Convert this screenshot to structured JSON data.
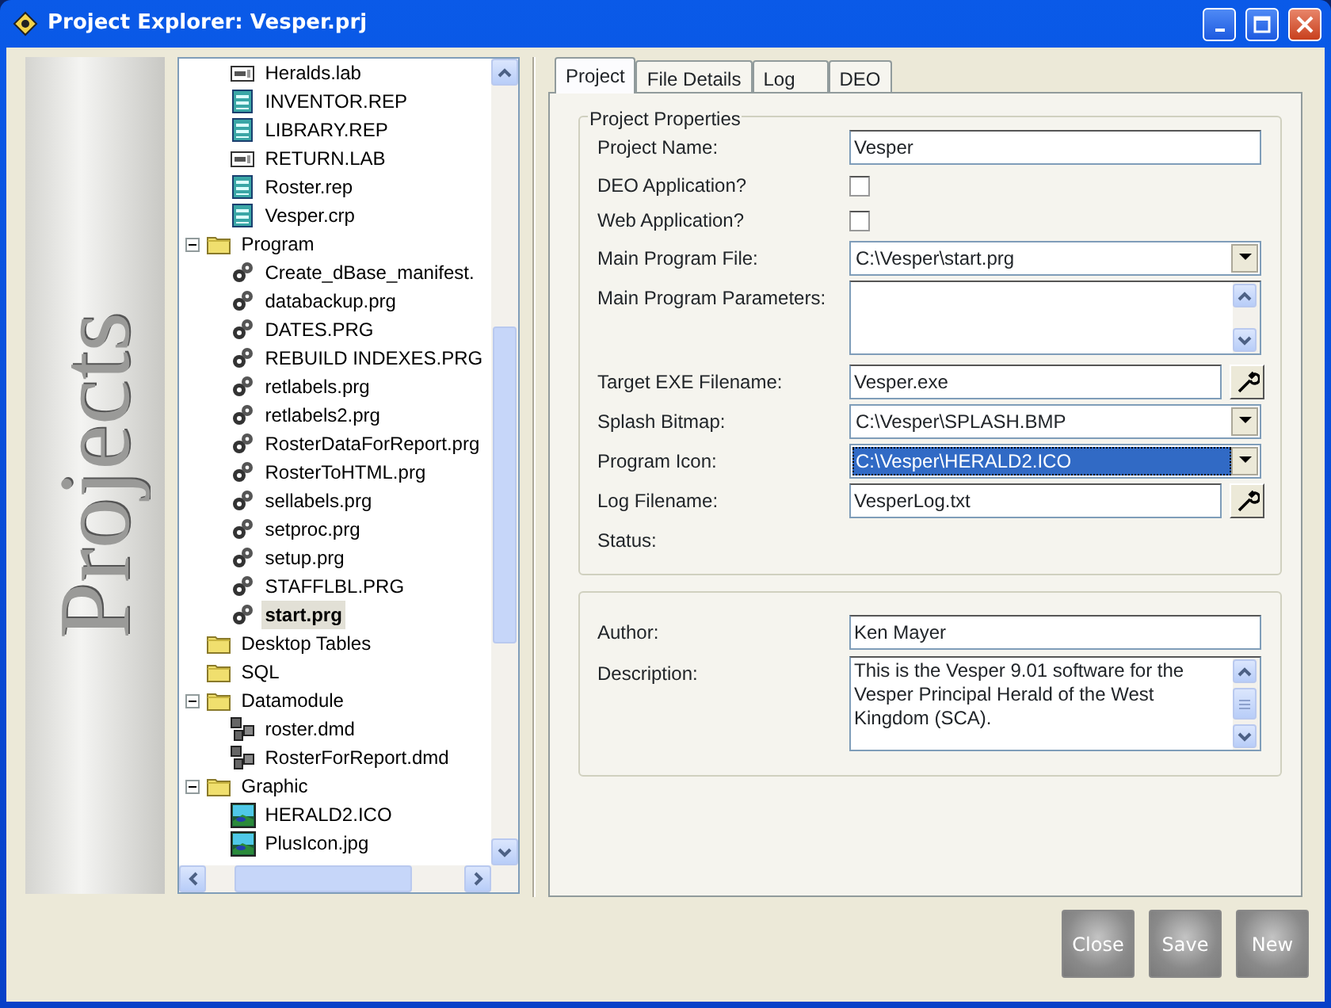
{
  "window": {
    "title": "Project Explorer: Vesper.prj"
  },
  "side_banner": {
    "text": "Projects"
  },
  "tree": {
    "continued_items": [
      {
        "label": "Heralds.lab",
        "kind": "label",
        "selected": false
      },
      {
        "label": "INVENTOR.REP",
        "kind": "report",
        "selected": false
      },
      {
        "label": "LIBRARY.REP",
        "kind": "report",
        "selected": false
      },
      {
        "label": "RETURN.LAB",
        "kind": "label",
        "selected": false
      },
      {
        "label": "Roster.rep",
        "kind": "report",
        "selected": false
      },
      {
        "label": "Vesper.crp",
        "kind": "report",
        "selected": false
      }
    ],
    "nodes": [
      {
        "label": "Program",
        "kind": "folder",
        "expanded": true,
        "selected": false,
        "children": [
          {
            "label": "Create_dBase_manifest.",
            "kind": "program",
            "selected": false
          },
          {
            "label": "databackup.prg",
            "kind": "program",
            "selected": false
          },
          {
            "label": "DATES.PRG",
            "kind": "program",
            "selected": false
          },
          {
            "label": "REBUILD INDEXES.PRG",
            "kind": "program",
            "selected": false
          },
          {
            "label": "retlabels.prg",
            "kind": "program",
            "selected": false
          },
          {
            "label": "retlabels2.prg",
            "kind": "program",
            "selected": false
          },
          {
            "label": "RosterDataForReport.prg",
            "kind": "program",
            "selected": false
          },
          {
            "label": "RosterToHTML.prg",
            "kind": "program",
            "selected": false
          },
          {
            "label": "sellabels.prg",
            "kind": "program",
            "selected": false
          },
          {
            "label": "setproc.prg",
            "kind": "program",
            "selected": false
          },
          {
            "label": "setup.prg",
            "kind": "program",
            "selected": false
          },
          {
            "label": "STAFFLBL.PRG",
            "kind": "program",
            "selected": false
          },
          {
            "label": "start.prg",
            "kind": "program",
            "selected": true
          }
        ]
      },
      {
        "label": "Desktop Tables",
        "kind": "folder",
        "selected": false
      },
      {
        "label": "SQL",
        "kind": "folder",
        "selected": false
      },
      {
        "label": "Datamodule",
        "kind": "folder",
        "expanded": true,
        "selected": false,
        "children": [
          {
            "label": "roster.dmd",
            "kind": "datamodule",
            "selected": false
          },
          {
            "label": "RosterForReport.dmd",
            "kind": "datamodule",
            "selected": false
          }
        ]
      },
      {
        "label": "Graphic",
        "kind": "folder",
        "expanded": true,
        "selected": false,
        "children": [
          {
            "label": "HERALD2.ICO",
            "kind": "image",
            "selected": false
          },
          {
            "label": "PlusIcon.jpg",
            "kind": "image",
            "selected": false
          }
        ]
      }
    ]
  },
  "tabs": [
    {
      "label": "Project",
      "selected": true
    },
    {
      "label": "File Details",
      "selected": false
    },
    {
      "label": "Log",
      "selected": false
    },
    {
      "label": "DEO",
      "selected": false
    }
  ],
  "project_properties": {
    "title": "Project Properties",
    "rows": [
      {
        "kind": "text",
        "label": "Project Name:",
        "value": "Vesper"
      },
      {
        "kind": "checkbox",
        "label": "DEO Application?",
        "checked": false
      },
      {
        "kind": "checkbox",
        "label": "Web Application?",
        "checked": false
      },
      {
        "kind": "combo",
        "label": "Main Program File:",
        "value": "C:\\Vesper\\start.prg",
        "selected": false
      },
      {
        "kind": "memo",
        "label": "Main Program Parameters:"
      },
      {
        "kind": "file",
        "label": "Target EXE Filename:",
        "value": "Vesper.exe"
      },
      {
        "kind": "combo",
        "label": "Splash Bitmap:",
        "value": "C:\\Vesper\\SPLASH.BMP",
        "selected": false
      },
      {
        "kind": "combo",
        "label": "Program Icon:",
        "value": "C:\\Vesper\\HERALD2.ICO",
        "selected": true
      },
      {
        "kind": "file",
        "label": "Log Filename:",
        "value": "VesperLog.txt"
      },
      {
        "kind": "status",
        "label": "Status:"
      }
    ]
  },
  "author_section": {
    "rows": [
      {
        "kind": "text",
        "label": "Author:",
        "value": "Ken Mayer"
      },
      {
        "kind": "memo",
        "label": "Description:",
        "value": "This is the Vesper 9.01 software for the Vesper Principal Herald of the West Kingdom (SCA)."
      }
    ]
  },
  "buttons": [
    {
      "label": "Close"
    },
    {
      "label": "Save"
    },
    {
      "label": "New"
    }
  ]
}
